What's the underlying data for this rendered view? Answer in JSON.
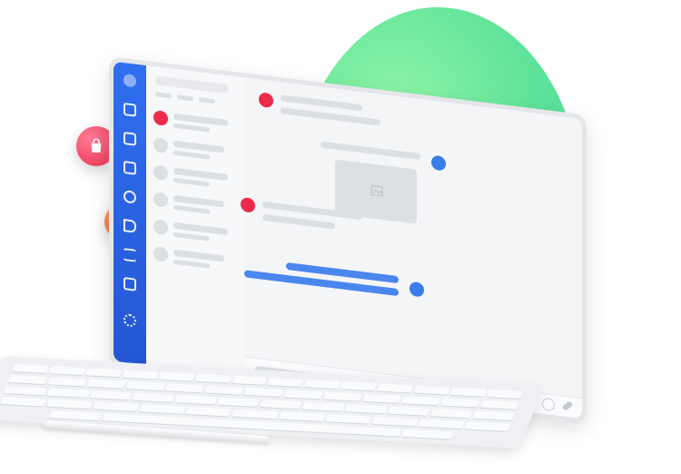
{
  "illustration": {
    "floating_icons": [
      {
        "name": "shopping-bag-icon",
        "color": "#2563e0"
      },
      {
        "name": "shopping-bag-icon",
        "color": "#f03a5a"
      },
      {
        "name": "html5-icon",
        "color": "#f26a34"
      }
    ],
    "accent_colors": {
      "sidebar": "#2f6ff0",
      "background_circle": "#5fe39a",
      "contact_avatar": "#ee2a4b",
      "message_bubble": "#4a86ee"
    },
    "sidebar_icons": [
      "dashboard-icon",
      "contacts-icon",
      "chat-icon",
      "refresh-icon",
      "megaphone-icon",
      "checklist-icon",
      "document-icon",
      "gear-icon"
    ],
    "composer_icons": [
      "emoji-icon",
      "attachment-icon"
    ]
  }
}
